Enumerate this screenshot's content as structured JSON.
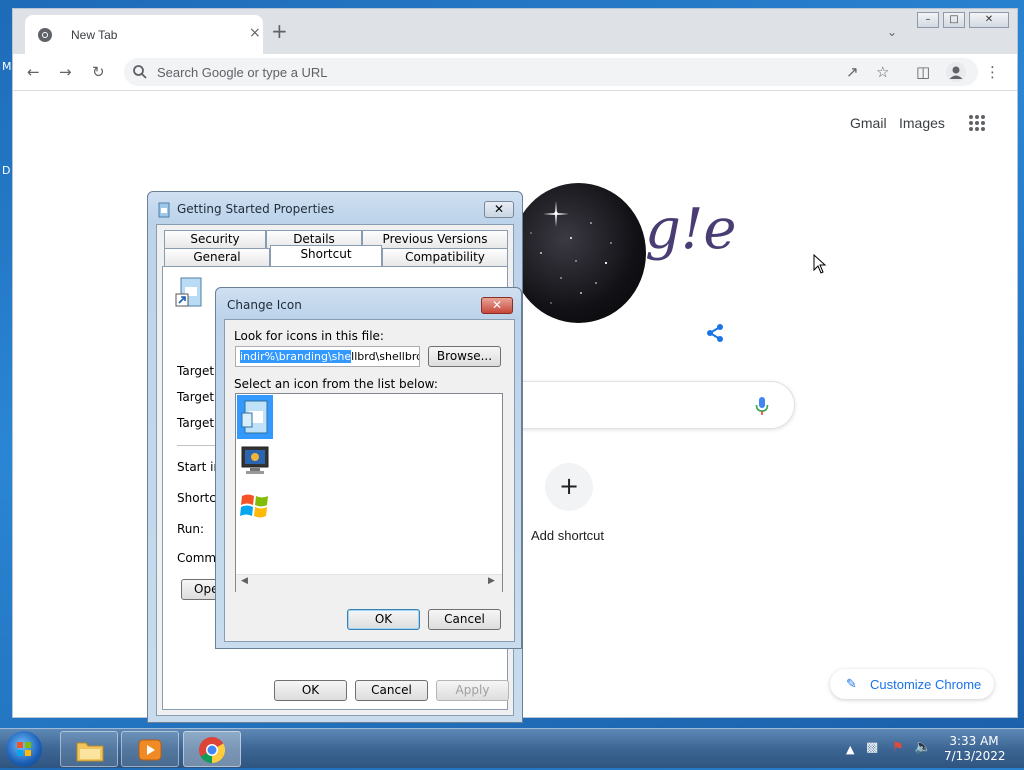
{
  "desktop": {
    "label_m": "M",
    "label_d": "D"
  },
  "browser": {
    "tab_title": "New Tab",
    "tab_close": "×",
    "new_tab": "+",
    "omnibox_placeholder": "Search Google or type a URL",
    "links": {
      "gmail": "Gmail",
      "images": "Images"
    },
    "add_shortcut_label": "Add shortcut",
    "add_shortcut_plus": "+",
    "customize_label": "Customize Chrome"
  },
  "properties_dialog": {
    "title": "Getting Started Properties",
    "tabs_row1": [
      "Security",
      "Details",
      "Previous Versions"
    ],
    "tabs_row2": [
      "General",
      "Shortcut",
      "Compatibility"
    ],
    "active_tab": "Shortcut",
    "field_labels": [
      "Target ty",
      "Target lo",
      "Target:",
      "Start in:",
      "Shortcut",
      "Run:",
      "Commen"
    ],
    "open_button": "Ope",
    "ok": "OK",
    "cancel": "Cancel",
    "apply": "Apply"
  },
  "change_icon_dialog": {
    "title": "Change Icon",
    "look_label": "Look for icons in this file:",
    "file_selected": "indir%\\branding\\she",
    "file_rest": "llbrd\\shellbrd.dll",
    "browse": "Browse...",
    "list_label": "Select an icon from the list below:",
    "ok": "OK",
    "cancel": "Cancel"
  },
  "taskbar": {
    "time": "3:33 AM",
    "date": "7/13/2022"
  },
  "colors": {
    "accent_blue": "#1a73e8",
    "selection": "#3399ff",
    "close_red": "#c7473b"
  }
}
